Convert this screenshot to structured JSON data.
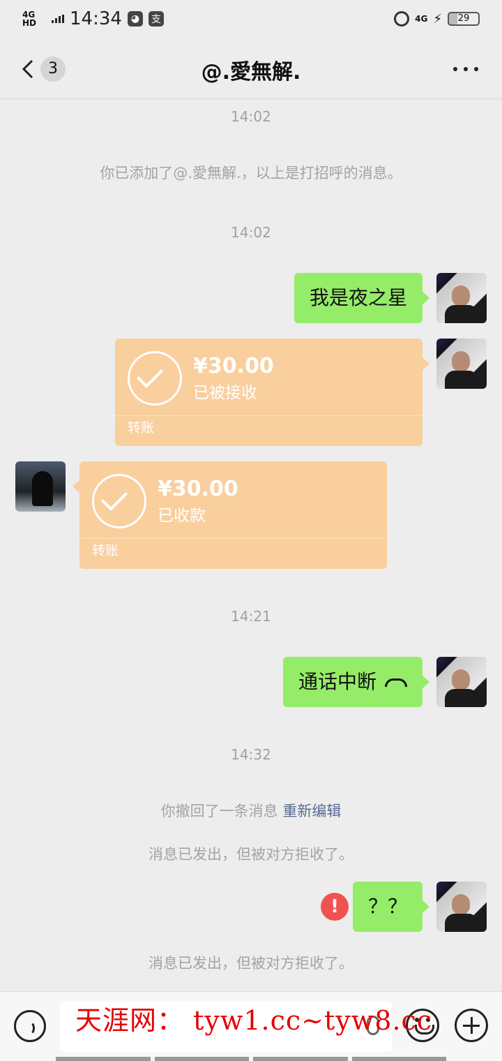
{
  "status_bar": {
    "network": "4G HD",
    "time": "14:34",
    "app_icon_label": "支",
    "network_right": "4G",
    "battery": "29",
    "battery_level": 0.29
  },
  "header": {
    "back_badge": "3",
    "title": "@.愛無解."
  },
  "messages": {
    "ts1": "14:02",
    "sys_added": "你已添加了@.愛無解.，以上是打招呼的消息。",
    "ts2": "14:02",
    "msg_intro": "我是夜之星",
    "transfer1": {
      "amount": "¥30.00",
      "status": "已被接收",
      "label": "转账"
    },
    "transfer2": {
      "amount": "¥30.00",
      "status": "已收款",
      "label": "转账"
    },
    "ts3": "14:21",
    "msg_call": "通话中断",
    "ts4": "14:32",
    "sys_recall": "你撤回了一条消息",
    "sys_recall_link": "重新编辑",
    "sys_rejected1": "消息已发出，但被对方拒收了。",
    "msg_question": "？？",
    "error_mark": "!",
    "sys_rejected2": "消息已发出，但被对方拒收了。"
  },
  "input_bar": {
    "watermark": "天涯网： tyw1.cc~tyw8.cc"
  },
  "icons": {
    "back": "chevron-left-icon",
    "more": "more-dots-icon",
    "hangup": "phone-hangup-icon",
    "check": "check-circle-icon",
    "error": "error-icon",
    "voice": "voice-icon",
    "mic": "microphone-icon",
    "emoji": "emoji-icon",
    "plus": "plus-circle-icon"
  },
  "colors": {
    "background": "#ededed",
    "my_bubble": "#95ec69",
    "transfer_card": "#f9cf9e",
    "link": "#576b95",
    "error": "#f05252",
    "watermark": "#e60000"
  }
}
